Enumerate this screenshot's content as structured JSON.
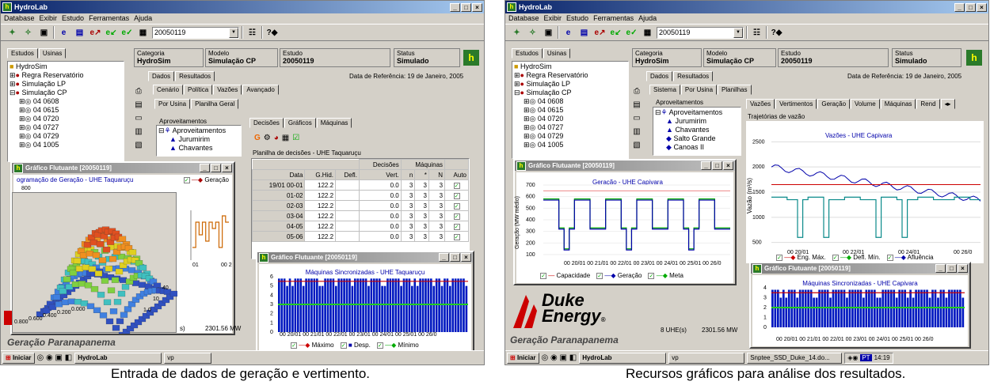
{
  "app": {
    "title": "HydroLab",
    "menu": [
      "Database",
      "Exibir",
      "Estudo",
      "Ferramentas",
      "Ajuda"
    ],
    "combo_value": "20050119"
  },
  "left": {
    "nav_tabs": [
      "Estudos",
      "Usinas"
    ],
    "info": {
      "cat_label": "Categoria",
      "cat_val": "HydroSim",
      "mod_label": "Modelo",
      "mod_val": "Simulação CP",
      "est_label": "Estudo",
      "est_val": "20050119",
      "st_label": "Status",
      "st_val": "Simulado"
    },
    "tree": [
      "HydroSim",
      "Regra Reservatório",
      "Simulação LP",
      "Simulação CP",
      "04 0608",
      "04 0615",
      "04 0720",
      "04 0727",
      "04 0729",
      "04 1005"
    ],
    "main_tabs": [
      "Dados",
      "Resultados"
    ],
    "ref_date": "Data de Referência: 19 de Janeiro, 2005",
    "sub_tabs": [
      "Cenário",
      "Política",
      "Vazões",
      "Avançado"
    ],
    "sub_tabs2": [
      "Por Usina",
      "Planilha Geral"
    ],
    "aprov_label": "Aproveitamentos",
    "aprov_items": [
      "Aproveitamentos",
      "Jurumirim",
      "Chavantes"
    ],
    "dec_tabs": [
      "Decisões",
      "Gráficos",
      "Máquinas"
    ],
    "sheet_title": "Planilha de decisões - UHE Taquaruçu",
    "sheet_headers": [
      "Data",
      "G.Hid.",
      "Defl.",
      "Vert.",
      "n",
      "*",
      "N",
      "Auto"
    ],
    "sheet_group1": "Decisões",
    "sheet_group2": "Máquinas",
    "rows": [
      [
        "19/01 00-01",
        "122.2",
        "",
        "0.0",
        "3",
        "3",
        "3"
      ],
      [
        "01-02",
        "122.2",
        "",
        "0.0",
        "3",
        "3",
        "3"
      ],
      [
        "02-03",
        "122.2",
        "",
        "0.0",
        "3",
        "3",
        "3"
      ],
      [
        "03-04",
        "122.2",
        "",
        "0.0",
        "3",
        "3",
        "3"
      ],
      [
        "04-05",
        "122.2",
        "",
        "0.0",
        "3",
        "3",
        "3"
      ],
      [
        "05-06",
        "122.2",
        "",
        "0.0",
        "3",
        "3",
        "3"
      ]
    ],
    "float1_title": "Gráfico Flutuante [20050119]",
    "float1_chart_title": "ogramação de Geração - UHE Taquaruçu",
    "float1_legend": "Geração",
    "float1_ytick": "800",
    "float1_xticks": [
      "01",
      "00 20"
    ],
    "surface_ticks": [
      "0.800",
      "0.600",
      "0.400",
      "0.200",
      "0.000",
      "1.0",
      "10",
      "40"
    ],
    "total_mw": "2301.56 MW",
    "total_s": "s)",
    "float2_title": "Gráfico Flutuante [20050119]",
    "float2_chart_title": "Máquinas Sincronizadas - UHE Taquaruçu",
    "float2_yticks": [
      "6",
      "5",
      "4",
      "3",
      "2",
      "1",
      "0"
    ],
    "float2_xticks": "00 20/01 00 21/01 00 22/01 00 23/01 00 24/01 00 25/01 00 26/0",
    "float2_legend": [
      "Máximo",
      "Desp.",
      "Mínimo"
    ],
    "brand": "Geração Paranapanema",
    "taskbar": {
      "start": "Iniciar",
      "app": "HydroLab",
      "vp": "vp"
    },
    "caption": "Entrada de dados de geração e vertimento."
  },
  "right": {
    "nav_tabs": [
      "Estudos",
      "Usinas"
    ],
    "info": {
      "cat_label": "Categoria",
      "cat_val": "HydroSim",
      "mod_label": "Modelo",
      "mod_val": "Simulação CP",
      "est_label": "Estudo",
      "est_val": "20050119",
      "st_label": "Status",
      "st_val": "Simulado"
    },
    "tree": [
      "HydroSim",
      "Regra Reservatório",
      "Simulação LP",
      "Simulação CP",
      "04 0608",
      "04 0615",
      "04 0720",
      "04 0727",
      "04 0729",
      "04 1005"
    ],
    "main_tabs": [
      "Dados",
      "Resultados"
    ],
    "ref_date": "Data de Referência: 19 de Janeiro, 2005",
    "sub_tabs": [
      "Sistema",
      "Por Usina",
      "Planilhas"
    ],
    "aprov_label": "Aproveitamentos",
    "aprov_items": [
      "Aproveitamentos",
      "Jurumirim",
      "Chavantes",
      "Salto Grande",
      "Canoas II"
    ],
    "chart_tabs": [
      "Vazões",
      "Vertimentos",
      "Geração",
      "Volume",
      "Máquinas",
      "Rend"
    ],
    "traj_label": "Trajetórias de vazão",
    "vaz_title": "Vazões - UHE Capivara",
    "vaz_ylabel": "Vazão (m³/s)",
    "vaz_yticks": [
      "2500",
      "2000",
      "1500",
      "1000",
      "500"
    ],
    "vaz_xticks": [
      "00 20/01",
      "00 22/01",
      "00 24/01",
      "00 26/0"
    ],
    "vaz_legend": [
      "Eng. Máx.",
      "Defl. Mín.",
      "Afluência"
    ],
    "float1_title": "Gráfico Flutuante [20050119]",
    "float1_chart_title": "Geração - UHE Capivara",
    "float1_ylabel": "Geração (MW médio)",
    "float1_yticks": [
      "700",
      "600",
      "500",
      "400",
      "300",
      "200",
      "100"
    ],
    "float1_xticks": "00 20/01 00 21/01 00 22/01 00 23/01 00 24/01 00 25/01 00 26/0",
    "float1_legend": [
      "Capacidade",
      "Geração",
      "Meta"
    ],
    "float2_title": "Gráfico Flutuante [20050119]",
    "float2_chart_title": "Máquinas Sincronizadas - UHE Capivara",
    "float2_yticks": [
      "4",
      "3",
      "2",
      "1",
      "0"
    ],
    "float2_xticks": "00 20/01 00 21/01 00 22/01 00 23/01 00 24/01 00 25/01 00 26/0",
    "uhe_count": "8 UHE(s)",
    "total_mw": "2301.56 MW",
    "duke1": "Duke",
    "duke2": "Energy",
    "brand": "Geração Paranapanema",
    "taskbar": {
      "start": "Iniciar",
      "app": "HydroLab",
      "vp": "vp",
      "doc": "Snptee_SSD_Duke_14.do...",
      "lang": "PT",
      "time": "14:19"
    },
    "caption": "Recursos gráficos para análise dos resultados."
  }
}
